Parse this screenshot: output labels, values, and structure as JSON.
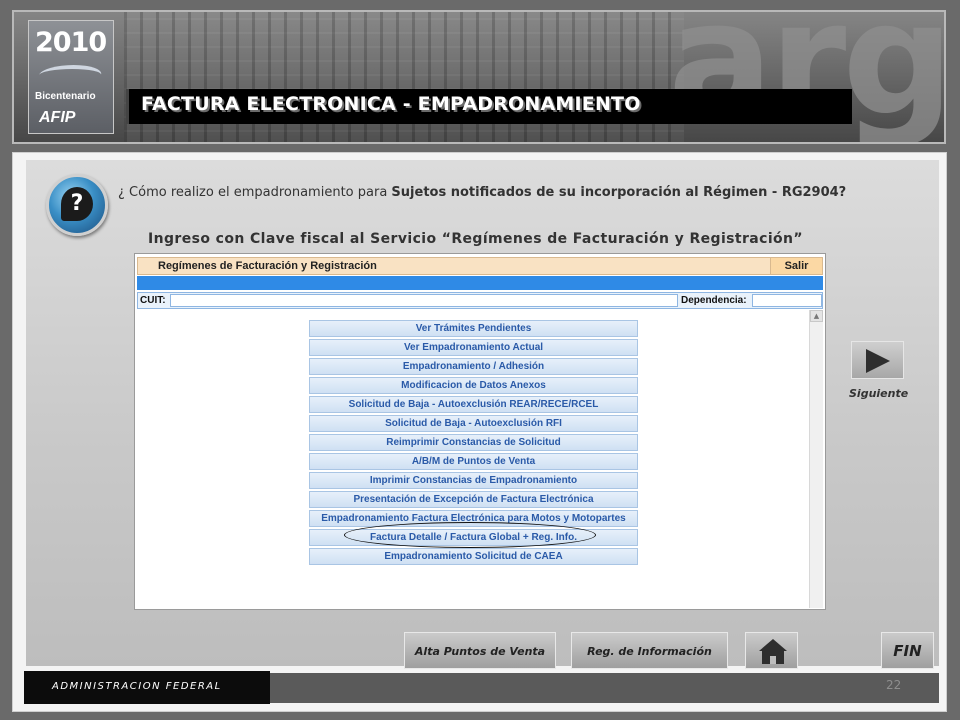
{
  "header": {
    "logo": {
      "year": "2010",
      "caption": "Bicentenario",
      "brand": "AFIP"
    },
    "watermark": "arg",
    "title": "FACTURA ELECTRONICA  - EMPADRONAMIENTO"
  },
  "question": {
    "prefix": "¿ Cómo realizo el empadronamiento para ",
    "bold": "Sujetos notificados de su incorporación al Régimen - RG2904?"
  },
  "subtitle": "Ingreso con Clave fiscal al Servicio “Regímenes de Facturación y Registración”",
  "screenshot": {
    "title": "Regímenes de Facturación y Registración",
    "salir": "Salir",
    "cuit_label": "CUIT:",
    "dependencia_label": "Dependencia:",
    "menu_items": [
      "Ver Trámites Pendientes",
      "Ver Empadronamiento Actual",
      "Empadronamiento / Adhesión",
      "Modificacion de Datos Anexos",
      "Solicitud de Baja - Autoexclusión REAR/RECE/RCEL",
      "Solicitud de Baja - Autoexclusión RFI",
      "Reimprimir Constancias de Solicitud",
      "A/B/M de Puntos de Venta",
      "Imprimir Constancias de Empadronamiento",
      "Presentación de Excepción de Factura Electrónica",
      "Empadronamiento Factura Electrónica para Motos y Motopartes",
      "Factura Detalle / Factura Global + Reg. Info.",
      "Empadronamiento Solicitud de CAEA"
    ],
    "highlighted_item": "Factura Detalle / Factura Global + Reg. Info."
  },
  "navigation": {
    "next_label": "Siguiente",
    "alta_label": "Alta Puntos de Venta",
    "reg_label": "Reg. de Información",
    "home_icon": "home-icon",
    "fin_label": "FIN"
  },
  "footer": {
    "org": "ADMINISTRACION FEDERAL",
    "page_number": "22"
  }
}
